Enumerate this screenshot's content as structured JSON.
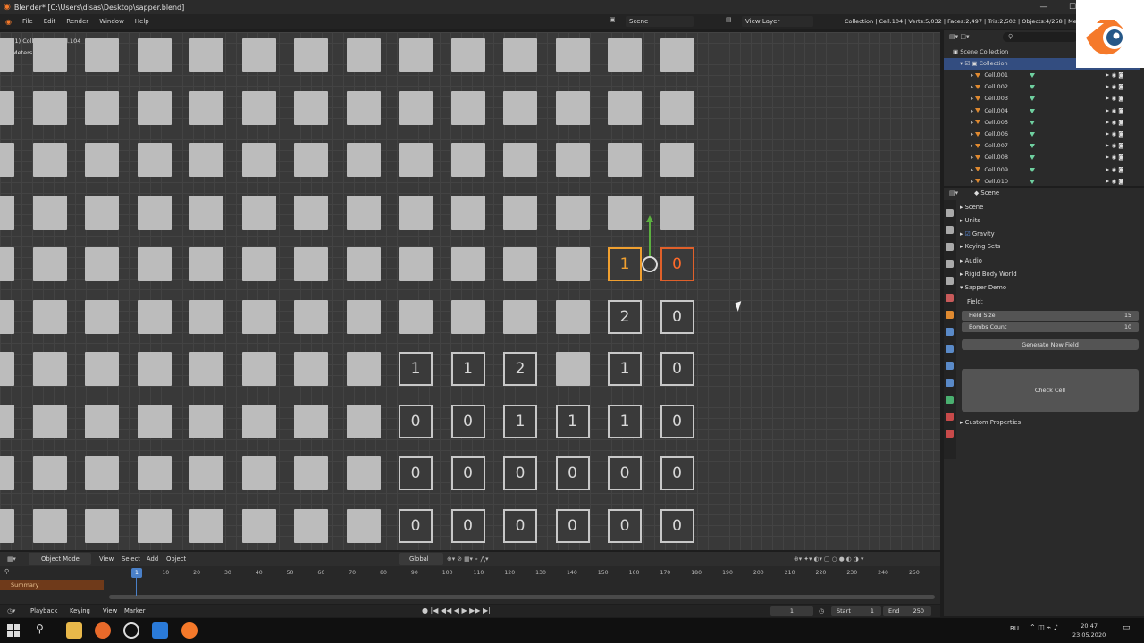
{
  "window": {
    "title": "Blender* [C:\\Users\\disas\\Desktop\\sapper.blend]",
    "minimize": "—",
    "maximize": "☐",
    "close": "✕"
  },
  "menu": [
    "File",
    "Edit",
    "Render",
    "Window",
    "Help"
  ],
  "scene_field": "Scene",
  "view_layer_field": "View Layer",
  "stats": "Collection | Cell.104 | Verts:5,032 | Faces:2,497 | Tris:2,502 | Objects:4/258 | Mem: 7",
  "viewport": {
    "info_line1": "(1) Collection | Cell.104",
    "info_line2": "Meters"
  },
  "grid": {
    "revealed": [
      [
        "",
        "",
        "",
        "",
        "",
        "",
        "",
        "",
        "",
        "",
        "",
        "",
        "",
        ""
      ],
      [
        "",
        "",
        "",
        "",
        "",
        "",
        "",
        "",
        "",
        "",
        "",
        "",
        "",
        ""
      ],
      [
        "",
        "",
        "",
        "",
        "",
        "",
        "",
        "",
        "",
        "",
        "",
        "",
        "",
        ""
      ],
      [
        "",
        "",
        "",
        "",
        "",
        "",
        "",
        "",
        "",
        "",
        "",
        "",
        "",
        ""
      ],
      [
        "",
        "",
        "",
        "",
        "",
        "",
        "",
        "",
        "",
        "",
        "",
        "",
        "1",
        "0"
      ],
      [
        "",
        "",
        "",
        "",
        "",
        "",
        "",
        "",
        "",
        "",
        "",
        "",
        "2",
        "0"
      ],
      [
        "",
        "",
        "",
        "",
        "",
        "",
        "",
        "",
        "1",
        "1",
        "2",
        "",
        "1",
        "0"
      ],
      [
        "",
        "",
        "",
        "",
        "",
        "",
        "",
        "",
        "0",
        "0",
        "1",
        "1",
        "1",
        "0"
      ],
      [
        "",
        "",
        "",
        "",
        "",
        "",
        "",
        "",
        "0",
        "0",
        "0",
        "0",
        "0",
        "0"
      ],
      [
        "",
        "",
        "",
        "",
        "",
        "",
        "",
        "",
        "0",
        "0",
        "0",
        "0",
        "0",
        "0"
      ]
    ],
    "selected_active": [
      4,
      13
    ],
    "selected_other": [
      4,
      12
    ]
  },
  "viewport_header": {
    "mode": "Object Mode",
    "view": "View",
    "select": "Select",
    "add": "Add",
    "object": "Object",
    "transform": "Global"
  },
  "timeline": {
    "ticks": [
      "1",
      "10",
      "20",
      "30",
      "40",
      "50",
      "60",
      "70",
      "80",
      "90",
      "100",
      "110",
      "120",
      "130",
      "140",
      "150",
      "160",
      "170",
      "180",
      "190",
      "200",
      "210",
      "220",
      "230",
      "240",
      "250"
    ],
    "current_frame": "1",
    "summary": "Summary",
    "header": {
      "playback": "Playback",
      "keying": "Keying",
      "view": "View",
      "marker": "Marker"
    },
    "frame_field": "1",
    "start_label": "Start",
    "start_value": "1",
    "end_label": "End",
    "end_value": "250"
  },
  "outliner": {
    "scene_collection": "Scene Collection",
    "collection": "Collection",
    "items": [
      "Cell.001",
      "Cell.002",
      "Cell.003",
      "Cell.004",
      "Cell.005",
      "Cell.006",
      "Cell.007",
      "Cell.008",
      "Cell.009",
      "Cell.010"
    ]
  },
  "properties": {
    "header": "Scene",
    "panels": [
      "Scene",
      "Units",
      "Gravity",
      "Keying Sets",
      "Audio",
      "Rigid Body World",
      "Sapper Demo"
    ],
    "field_label": "Field:",
    "field_size_label": "Field Size",
    "field_size_value": "15",
    "bombs_label": "Bombs Count",
    "bombs_value": "10",
    "generate_button": "Generate New Field",
    "check_button": "Check Cell",
    "custom_props": "Custom Properties"
  },
  "taskbar": {
    "lang": "RU",
    "time": "20:47",
    "date": "23.05.2020"
  },
  "colors": {
    "accent_selected": "#e0602a",
    "accent_active": "#f0a030",
    "outliner_selection": "#334d80",
    "timeline_playhead": "#4a80c8"
  }
}
